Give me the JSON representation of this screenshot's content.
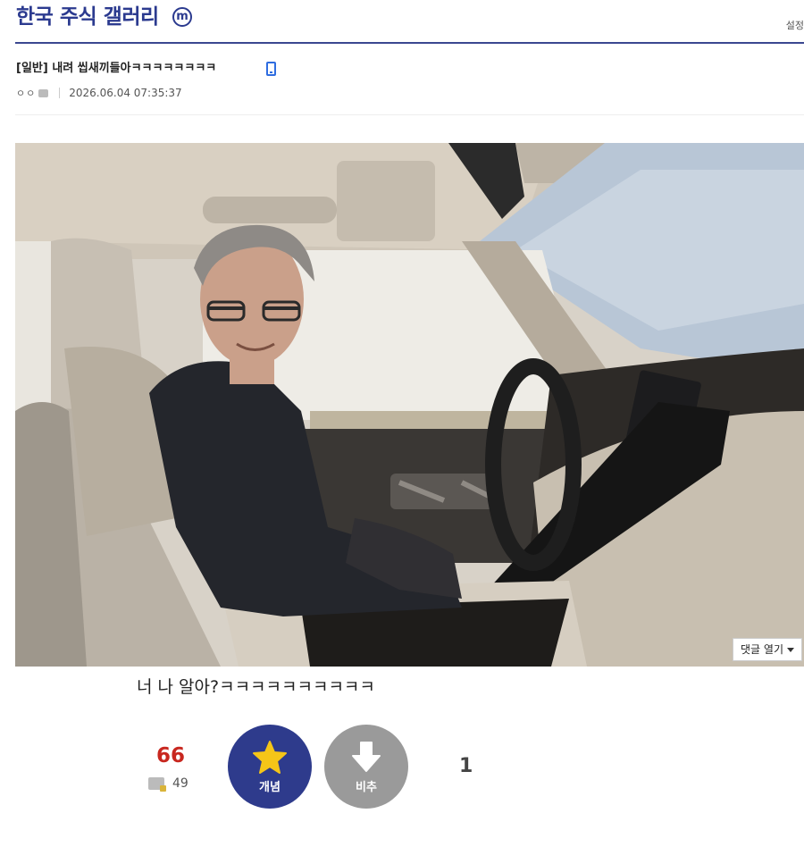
{
  "gallery": {
    "title": "한국 주식 갤러리",
    "badge": "m",
    "settings_label": "설정"
  },
  "post": {
    "title": "[일반] 내려 씹새끼들아ㅋㅋㅋㅋㅋㅋㅋㅋ",
    "author": "ㅇㅇ",
    "date": "2026.06.04 07:35:37",
    "body_text": "너 나 알아?ㅋㅋㅋㅋㅋㅋㅋㅋㅋㅋ",
    "comment_toggle_label": "댓글 열기"
  },
  "votes": {
    "up_count": "66",
    "fixed_count": "49",
    "concept_label": "개념",
    "nonrec_label": "비추",
    "down_count": "1"
  },
  "icons": {
    "mobile": "mobile-icon",
    "user": "user-icon",
    "fixed": "fixed-user-icon",
    "star": "star-icon",
    "down_arrow": "down-arrow-icon"
  },
  "colors": {
    "brand": "#2b3a8f",
    "up_count": "#c8271f",
    "concept_button": "#2e3b8c",
    "nonrec_button": "#9a9a9a",
    "star": "#f5c518"
  }
}
